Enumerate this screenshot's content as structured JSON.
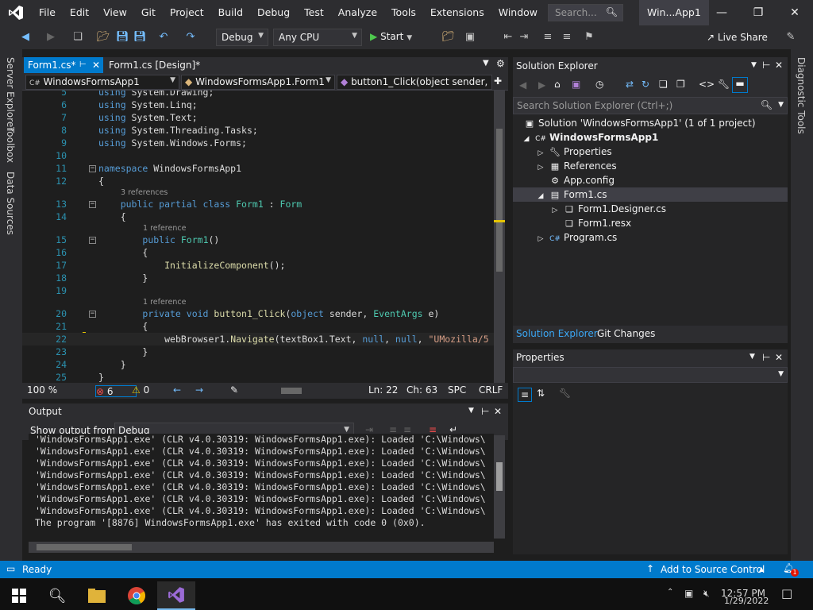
{
  "menu": {
    "items": [
      "File",
      "Edit",
      "View",
      "Git",
      "Project",
      "Build",
      "Debug",
      "Test",
      "Analyze",
      "Tools",
      "Extensions",
      "Window",
      "Help"
    ],
    "search_placeholder": "Search...",
    "window_title": "Win...App1"
  },
  "toolbar": {
    "config": "Debug",
    "platform": "Any CPU",
    "start_label": "Start",
    "liveshare_label": "Live Share"
  },
  "left_strip": {
    "tabs": [
      "Server Explorer",
      "Toolbox",
      "Data Sources"
    ]
  },
  "right_strip": {
    "tabs": [
      "Diagnostic Tools"
    ]
  },
  "editor": {
    "tabs": [
      {
        "label": "Form1.cs*",
        "active": true
      },
      {
        "label": "Form1.cs [Design]*",
        "active": false
      }
    ],
    "nav": {
      "project": "WindowsFormsApp1",
      "class": "WindowsFormsApp1.Form1",
      "member": "button1_Click(object sender, E"
    },
    "lines": [
      {
        "n": "5",
        "text": "using System.Drawing;"
      },
      {
        "n": "6",
        "text": "using System.Linq;"
      },
      {
        "n": "7",
        "text": "using System.Text;"
      },
      {
        "n": "8",
        "text": "using System.Threading.Tasks;"
      },
      {
        "n": "9",
        "text": "using System.Windows.Forms;"
      },
      {
        "n": "10",
        "text": ""
      },
      {
        "n": "11",
        "text": "namespace WindowsFormsApp1"
      },
      {
        "n": "12",
        "text": "{"
      },
      {
        "n": "13",
        "text": "    public partial class Form1 : Form"
      },
      {
        "n": "14",
        "text": "    {"
      },
      {
        "n": "15",
        "text": "        public Form1()"
      },
      {
        "n": "16",
        "text": "        {"
      },
      {
        "n": "17",
        "text": "            InitializeComponent();"
      },
      {
        "n": "18",
        "text": "        }"
      },
      {
        "n": "19",
        "text": ""
      },
      {
        "n": "20",
        "text": "        private void button1_Click(object sender, EventArgs e)"
      },
      {
        "n": "21",
        "text": "        {"
      },
      {
        "n": "22",
        "text": "            webBrowser1.Navigate(textBox1.Text, null, null, \"UMozilla/5"
      },
      {
        "n": "23",
        "text": "        }"
      },
      {
        "n": "24",
        "text": "    }"
      },
      {
        "n": "25",
        "text": "}"
      }
    ],
    "refs": {
      "class_refs": "3 references",
      "ctor_refs": "1 reference",
      "click_refs": "1 reference"
    },
    "status": {
      "zoom": "100 %",
      "errors": "6",
      "warnings": "0",
      "line": "Ln: 22",
      "col": "Ch: 63",
      "mode": "SPC",
      "eol": "CRLF"
    }
  },
  "output": {
    "title": "Output",
    "show_from_label": "Show output from:",
    "show_from_value": "Debug",
    "lines": [
      "'WindowsFormsApp1.exe' (CLR v4.0.30319: WindowsFormsApp1.exe): Loaded 'C:\\Windows\\",
      "'WindowsFormsApp1.exe' (CLR v4.0.30319: WindowsFormsApp1.exe): Loaded 'C:\\Windows\\",
      "'WindowsFormsApp1.exe' (CLR v4.0.30319: WindowsFormsApp1.exe): Loaded 'C:\\Windows\\",
      "'WindowsFormsApp1.exe' (CLR v4.0.30319: WindowsFormsApp1.exe): Loaded 'C:\\Windows\\",
      "'WindowsFormsApp1.exe' (CLR v4.0.30319: WindowsFormsApp1.exe): Loaded 'C:\\Windows\\",
      "'WindowsFormsApp1.exe' (CLR v4.0.30319: WindowsFormsApp1.exe): Loaded 'C:\\Windows\\",
      "'WindowsFormsApp1.exe' (CLR v4.0.30319: WindowsFormsApp1.exe): Loaded 'C:\\Windows\\",
      "The program '[8876] WindowsFormsApp1.exe' has exited with code 0 (0x0)."
    ]
  },
  "solution_explorer": {
    "title": "Solution Explorer",
    "search_placeholder": "Search Solution Explorer (Ctrl+;)",
    "solution": "Solution 'WindowsFormsApp1' (1 of 1 project)",
    "project": "WindowsFormsApp1",
    "items": {
      "properties": "Properties",
      "references": "References",
      "appconfig": "App.config",
      "form1": "Form1.cs",
      "designer": "Form1.Designer.cs",
      "resx": "Form1.resx",
      "program": "Program.cs"
    },
    "tabs": [
      "Solution Explorer",
      "Git Changes"
    ]
  },
  "properties": {
    "title": "Properties"
  },
  "statusbar": {
    "ready": "Ready",
    "source_control": "Add to Source Control",
    "notifications": "1"
  },
  "taskbar": {
    "time": "12:57 PM",
    "date": "1/29/2022"
  },
  "colors": {
    "accent": "#007acc",
    "chrome": "#2d2d30",
    "editor_bg": "#1e1e1e",
    "vs_purple": "#68217a"
  }
}
